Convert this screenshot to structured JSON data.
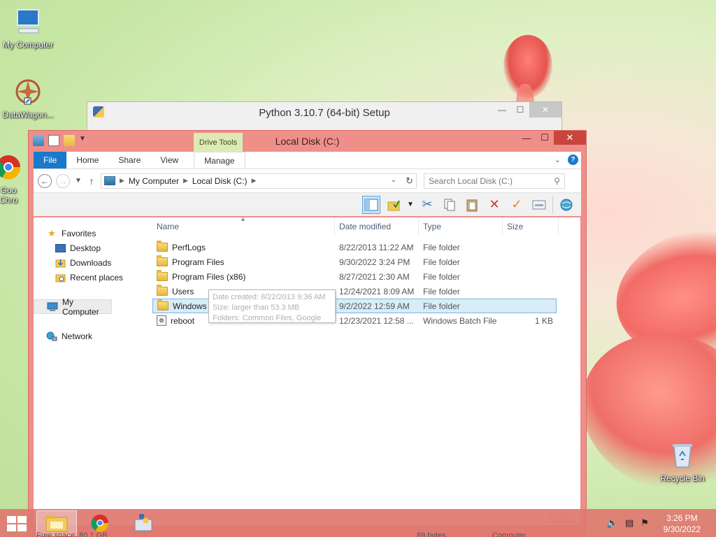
{
  "desktop": {
    "icons": [
      {
        "label": "My Computer"
      },
      {
        "label": "DataWagon..."
      },
      {
        "label": "Goo\nChro"
      },
      {
        "label": "Recycle Bin"
      }
    ]
  },
  "python_setup": {
    "title": "Python 3.10.7 (64-bit) Setup"
  },
  "explorer": {
    "title": "Local Disk (C:)",
    "contextual_tab": "Drive Tools",
    "tabs": [
      "File",
      "Home",
      "Share",
      "View",
      "Manage"
    ],
    "address": {
      "crumbs": [
        "My Computer",
        "Local Disk (C:)"
      ]
    },
    "search": {
      "placeholder": "Search Local Disk (C:)"
    },
    "nav": {
      "favorites": "Favorites",
      "desktop": "Desktop",
      "downloads": "Downloads",
      "recent": "Recent places",
      "computer": "My Computer",
      "network": "Network"
    },
    "columns": {
      "name": "Name",
      "date": "Date modified",
      "type": "Type",
      "size": "Size"
    },
    "files": [
      {
        "name": "PerfLogs",
        "date": "8/22/2013 11:22 AM",
        "type": "File folder",
        "size": ""
      },
      {
        "name": "Program Files",
        "date": "9/30/2022 3:24 PM",
        "type": "File folder",
        "size": ""
      },
      {
        "name": "Program Files (x86)",
        "date": "8/27/2021 2:30 AM",
        "type": "File folder",
        "size": ""
      },
      {
        "name": "Users",
        "date": "12/24/2021 8:09 AM",
        "type": "File folder",
        "size": ""
      },
      {
        "name": "Windows",
        "date": "9/2/2022 12:59 AM",
        "type": "File folder",
        "size": ""
      },
      {
        "name": "reboot",
        "date": "12/23/2021 12:58 ...",
        "type": "Windows Batch File",
        "size": "1 KB"
      }
    ],
    "tooltip": {
      "line1": "Date created: 8/22/2013 9:36 AM",
      "line2": "Size: larger than 53.3 MB",
      "line3": "Folders: Common Files, Google"
    }
  },
  "taskbar": {
    "time": "3:26 PM",
    "date": "9/30/2022",
    "ghost_left": "Free space: 80.1 GB",
    "ghost_mid": "89 bytes",
    "ghost_right": "Computer"
  }
}
